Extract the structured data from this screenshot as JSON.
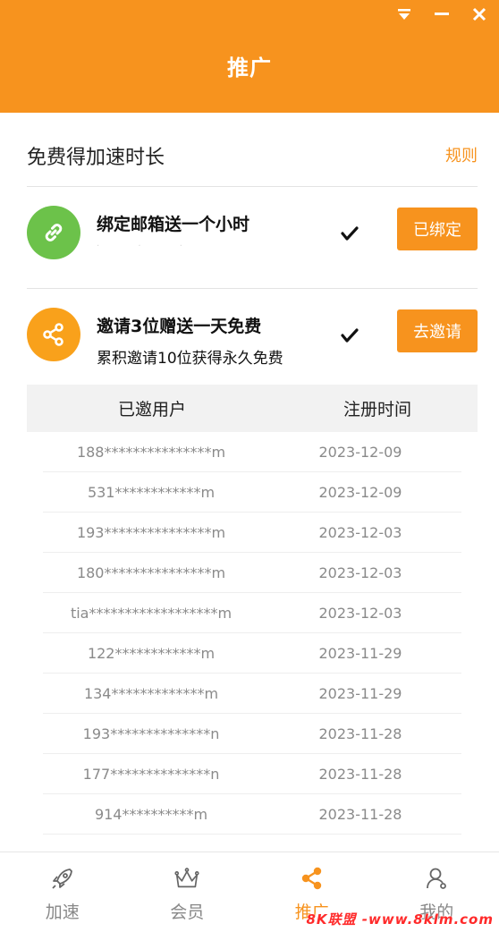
{
  "window": {
    "controls": [
      "dropdown-icon",
      "minimize-icon",
      "close-icon"
    ]
  },
  "header": {
    "title": "推广"
  },
  "section": {
    "title": "免费得加速时长",
    "rules_label": "规则"
  },
  "tasks": [
    {
      "title": "绑定邮箱送一个小时",
      "subtitle": "·  ·  ·",
      "icon": "link-icon",
      "icon_color": "#6cc24a",
      "done": true,
      "button_label": "已绑定"
    },
    {
      "title": "邀请3位赠送一天免费",
      "subtitle": "累积邀请10位获得永久免费",
      "icon": "share-icon",
      "icon_color": "#f9a11b",
      "done": true,
      "button_label": "去邀请"
    }
  ],
  "invite_table": {
    "columns": [
      "已邀用户",
      "注册时间"
    ],
    "rows": [
      {
        "user": "188***************m",
        "time": "2023-12-09"
      },
      {
        "user": "531************m",
        "time": "2023-12-09"
      },
      {
        "user": "193***************m",
        "time": "2023-12-03"
      },
      {
        "user": "180***************m",
        "time": "2023-12-03"
      },
      {
        "user": "tia******************m",
        "time": "2023-12-03"
      },
      {
        "user": "122************m",
        "time": "2023-11-29"
      },
      {
        "user": "134*************m",
        "time": "2023-11-29"
      },
      {
        "user": "193**************n",
        "time": "2023-11-28"
      },
      {
        "user": "177**************n",
        "time": "2023-11-28"
      },
      {
        "user": "914**********m",
        "time": "2023-11-28"
      }
    ]
  },
  "bottom_nav": [
    {
      "label": "加速",
      "icon": "rocket-icon",
      "active": false
    },
    {
      "label": "会员",
      "icon": "crown-icon",
      "active": false
    },
    {
      "label": "推广",
      "icon": "share-icon",
      "active": true
    },
    {
      "label": "我的",
      "icon": "user-icon",
      "active": false
    }
  ],
  "watermark": "8K联盟 -www.8klm.com",
  "colors": {
    "accent": "#f7931e",
    "text": "#222222",
    "muted": "#8a8a8a"
  }
}
